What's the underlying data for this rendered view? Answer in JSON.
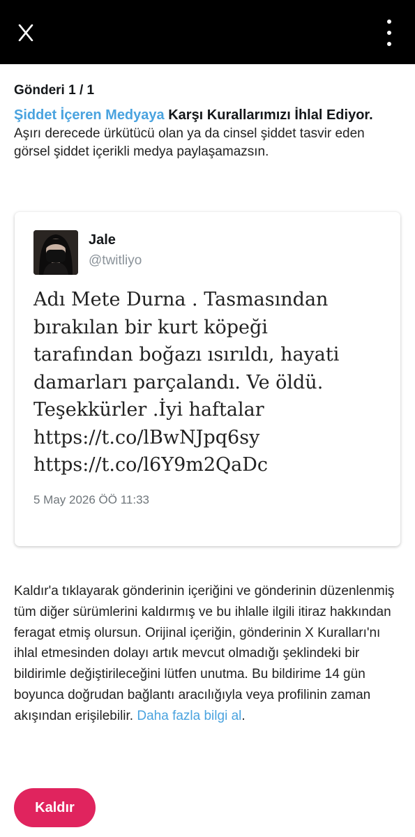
{
  "header": {
    "close_icon": "close-x-icon",
    "menu_icon": "more-vertical-icon"
  },
  "post": {
    "count_label": "Gönderi 1 / 1",
    "rule_link": "Şiddet İçeren Medyaya",
    "rule_rest": " Karşı Kurallarımızı İhlal Ediyor.",
    "rule_description": "Aşırı derecede ürkütücü olan ya da cinsel şiddet tasvir eden görsel şiddet içerikli medya paylaşamazsın."
  },
  "tweet": {
    "author_name": "Jale",
    "author_handle": "@twitliyo",
    "text": "Adı Mete Durna . Tasmasından\nbırakılan bir kurt köpeği\ntarafından boğazı ısırıldı, hayati\ndamarları parçalandı. Ve öldü.\nTeşekkürler .İyi haftalar\nhttps://t.co/lBwNJpq6sy\nhttps://t.co/l6Y9m2QaDc",
    "timestamp": "5 May 2026 ÖÖ 11:33"
  },
  "notice": {
    "text": "Kaldır'a tıklayarak gönderinin içeriğini ve gönderinin düzenlenmiş tüm diğer sürümlerini kaldırmış ve bu ihlalle ilgili itiraz hakkından feragat etmiş olursun. Orijinal içeriğin, gönderinin X Kuralları'nı ihlal etmesinden dolayı artık mevcut olmadığı şeklindeki bir bildirimle değiştirileceğini lütfen unutma. Bu bildirime 14 gün boyunca doğrudan bağlantı aracılığıyla veya profilinin zaman akışından erişilebilir. ",
    "learn_more": "Daha fazla bilgi al",
    "end": "."
  },
  "actions": {
    "remove_label": "Kaldır"
  },
  "colors": {
    "link": "#4aa3df",
    "primary_button": "#e0245e",
    "topbar": "#000000"
  }
}
